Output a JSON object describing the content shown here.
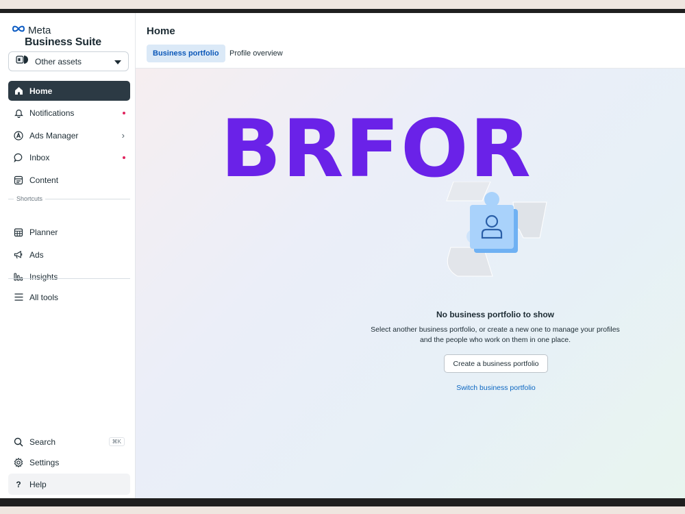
{
  "app": {
    "logo_meta": "Meta",
    "logo_product": "Business Suite",
    "accent": "#2c3a44"
  },
  "asset_selector": {
    "label": "Other assets"
  },
  "nav": {
    "home": "Home",
    "notifications": "Notifications",
    "ads_manager": "Ads Manager",
    "inbox": "Inbox",
    "content": "Content",
    "shortcuts": "Shortcuts",
    "planner": "Planner",
    "ads": "Ads",
    "insights": "Insights",
    "all_tools": "All tools",
    "search": "Search",
    "search_shortcut": "⌘K",
    "settings": "Settings",
    "help": "Help"
  },
  "header": {
    "title": "Home",
    "tabs": [
      {
        "label": "Business portfolio",
        "active": true
      },
      {
        "label": "Profile overview",
        "active": false
      }
    ]
  },
  "empty_state": {
    "title": "No business portfolio to show",
    "description_line1": "Select another business portfolio, or create a new one to manage your profiles",
    "description_line2": "and the people who work on them in one place.",
    "create_button": "Create a business portfolio",
    "switch_link": "Switch business portfolio"
  },
  "overlay_text": "BRFOR",
  "colors": {
    "overlay": "#6a22e8",
    "notification_dot": "#e0245e",
    "link": "#0b66c2"
  }
}
